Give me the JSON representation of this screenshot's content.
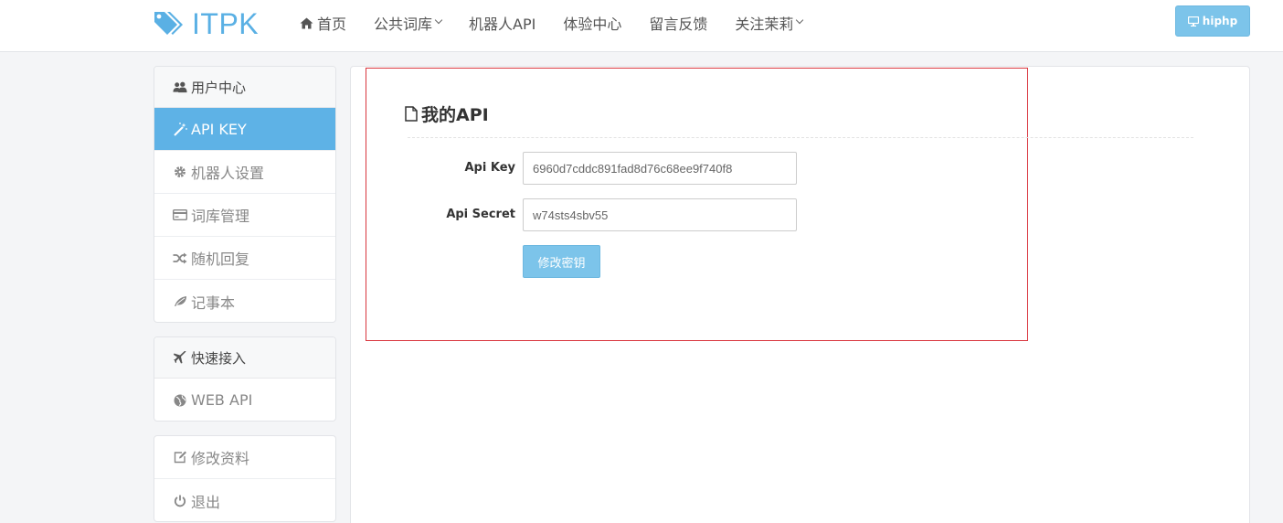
{
  "header": {
    "brand": "ITPK",
    "nav": [
      {
        "label": "首页",
        "icon": "home-icon",
        "dropdown": false
      },
      {
        "label": "公共词库",
        "icon": "",
        "dropdown": true
      },
      {
        "label": "机器人API",
        "icon": "",
        "dropdown": false
      },
      {
        "label": "体验中心",
        "icon": "",
        "dropdown": false
      },
      {
        "label": "留言反馈",
        "icon": "",
        "dropdown": false
      },
      {
        "label": "关注茉莉",
        "icon": "",
        "dropdown": true
      }
    ],
    "user_button": "hiphp"
  },
  "sidebar": {
    "user_center": {
      "title": "用户中心",
      "items": [
        {
          "label": "API KEY",
          "icon": "magic-wand-icon",
          "active": true
        },
        {
          "label": "机器人设置",
          "icon": "gear-icon",
          "active": false
        },
        {
          "label": "词库管理",
          "icon": "credit-card-icon",
          "active": false
        },
        {
          "label": "随机回复",
          "icon": "shuffle-icon",
          "active": false
        },
        {
          "label": "记事本",
          "icon": "leaf-icon",
          "active": false
        }
      ]
    },
    "quick_access": {
      "title": "快速接入",
      "items": [
        {
          "label": "WEB API",
          "icon": "globe-icon"
        }
      ]
    },
    "account": {
      "items": [
        {
          "label": "修改资料",
          "icon": "edit-icon"
        },
        {
          "label": "退出",
          "icon": "power-icon"
        }
      ]
    }
  },
  "main": {
    "title": "我的API",
    "fields": [
      {
        "label": "Api Key",
        "value": "6960d7cddc891fad8d76c68ee9f740f8"
      },
      {
        "label": "Api Secret",
        "value": "w74sts4sbv55"
      }
    ],
    "submit_label": "修改密钥"
  },
  "colors": {
    "accent": "#5eb2e6",
    "button": "#7cc4ea",
    "highlight_border": "#d9363e"
  }
}
